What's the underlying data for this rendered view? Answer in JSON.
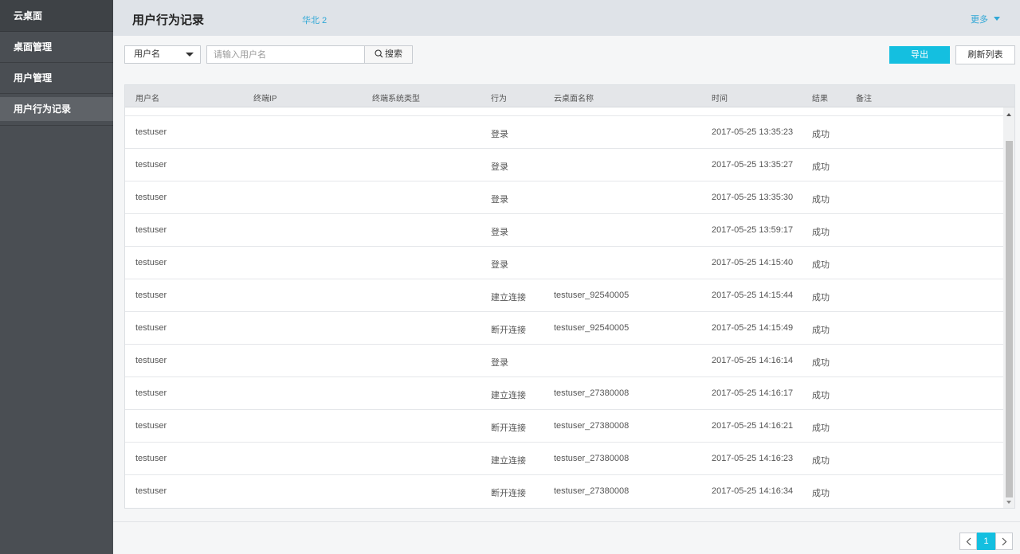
{
  "sidebar": {
    "header": "云桌面",
    "items": [
      {
        "label": "桌面管理"
      },
      {
        "label": "用户管理"
      },
      {
        "label": "用户行为记录"
      }
    ]
  },
  "topbar": {
    "title": "用户行为记录",
    "region": "华北 2",
    "more_label": "更多"
  },
  "toolbar": {
    "filter_selected": "用户名",
    "search_placeholder": "请输入用户名",
    "search_value": "",
    "search_label": "搜索",
    "export_label": "导出",
    "refresh_label": "刷新列表"
  },
  "table": {
    "columns": [
      "用户名",
      "终端IP",
      "终端系统类型",
      "行为",
      "云桌面名称",
      "时间",
      "结果",
      "备注"
    ],
    "rows": [
      {
        "user": "testuser",
        "ip": "",
        "os": "",
        "action": "登录",
        "desktop": "",
        "time": "2017-05-25 13:35:23",
        "result": "成功",
        "note": ""
      },
      {
        "user": "testuser",
        "ip": "",
        "os": "",
        "action": "登录",
        "desktop": "",
        "time": "2017-05-25 13:35:27",
        "result": "成功",
        "note": ""
      },
      {
        "user": "testuser",
        "ip": "",
        "os": "",
        "action": "登录",
        "desktop": "",
        "time": "2017-05-25 13:35:30",
        "result": "成功",
        "note": ""
      },
      {
        "user": "testuser",
        "ip": "",
        "os": "",
        "action": "登录",
        "desktop": "",
        "time": "2017-05-25 13:59:17",
        "result": "成功",
        "note": ""
      },
      {
        "user": "testuser",
        "ip": "",
        "os": "",
        "action": "登录",
        "desktop": "",
        "time": "2017-05-25 14:15:40",
        "result": "成功",
        "note": ""
      },
      {
        "user": "testuser",
        "ip": "",
        "os": "",
        "action": "建立连接",
        "desktop": "testuser_92540005",
        "time": "2017-05-25 14:15:44",
        "result": "成功",
        "note": ""
      },
      {
        "user": "testuser",
        "ip": "",
        "os": "",
        "action": "断开连接",
        "desktop": "testuser_92540005",
        "time": "2017-05-25 14:15:49",
        "result": "成功",
        "note": ""
      },
      {
        "user": "testuser",
        "ip": "",
        "os": "",
        "action": "登录",
        "desktop": "",
        "time": "2017-05-25 14:16:14",
        "result": "成功",
        "note": ""
      },
      {
        "user": "testuser",
        "ip": "",
        "os": "",
        "action": "建立连接",
        "desktop": "testuser_27380008",
        "time": "2017-05-25 14:16:17",
        "result": "成功",
        "note": ""
      },
      {
        "user": "testuser",
        "ip": "",
        "os": "",
        "action": "断开连接",
        "desktop": "testuser_27380008",
        "time": "2017-05-25 14:16:21",
        "result": "成功",
        "note": ""
      },
      {
        "user": "testuser",
        "ip": "",
        "os": "",
        "action": "建立连接",
        "desktop": "testuser_27380008",
        "time": "2017-05-25 14:16:23",
        "result": "成功",
        "note": ""
      },
      {
        "user": "testuser",
        "ip": "",
        "os": "",
        "action": "断开连接",
        "desktop": "testuser_27380008",
        "time": "2017-05-25 14:16:34",
        "result": "成功",
        "note": ""
      }
    ]
  },
  "pagination": {
    "current_page": "1",
    "prev_icon": "chevron-left-icon",
    "next_icon": "chevron-right-icon"
  },
  "colors": {
    "accent": "#14bfe0",
    "link": "#2fa7d6",
    "sidebar_bg": "#4a4e53"
  }
}
